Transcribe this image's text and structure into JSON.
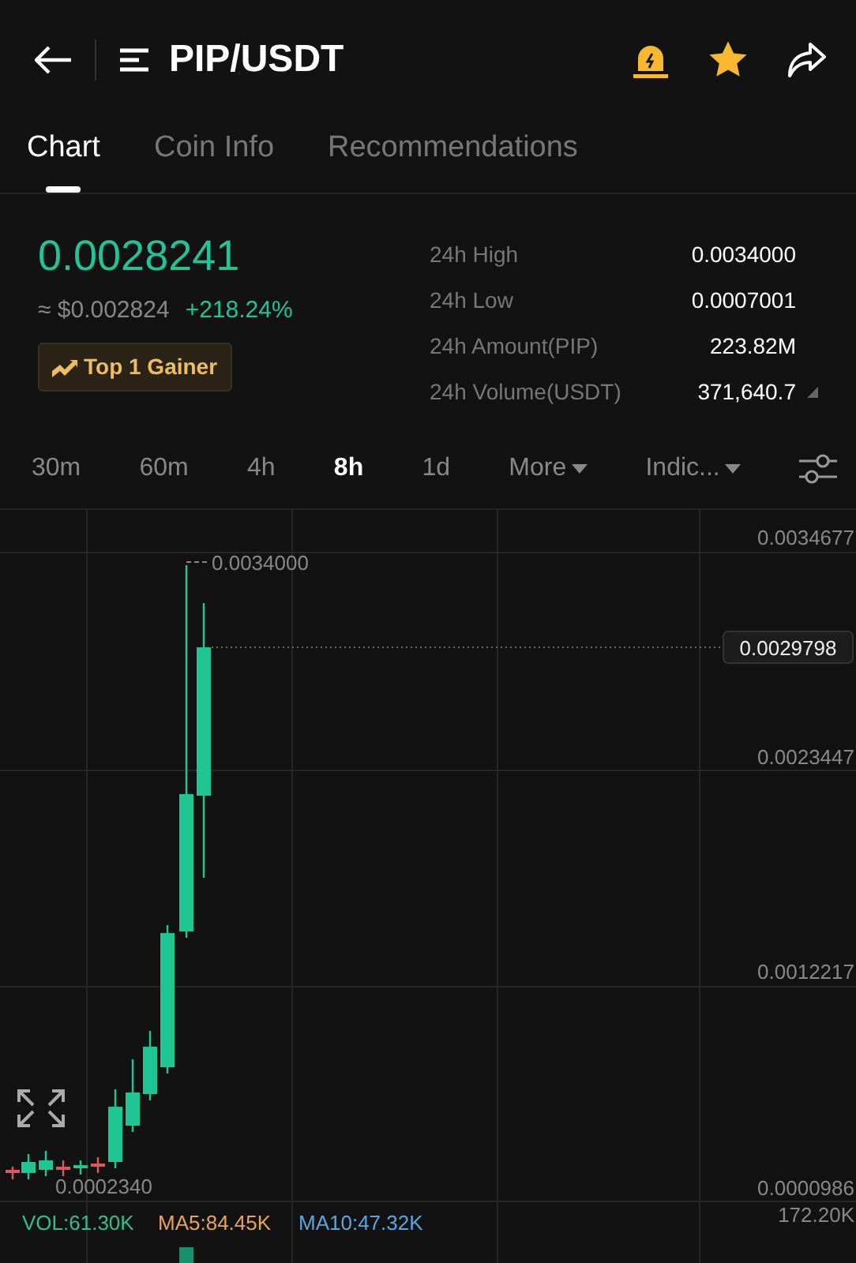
{
  "header": {
    "title": "PIP/USDT"
  },
  "tabs": [
    {
      "label": "Chart",
      "selected": true
    },
    {
      "label": "Coin Info",
      "selected": false
    },
    {
      "label": "Recommendations",
      "selected": false
    }
  ],
  "ticker": {
    "price": "0.0028241",
    "usd_price": "≈ $0.002824",
    "change": "+218.24%",
    "badge": "Top 1 Gainer"
  },
  "stats": [
    {
      "label": "24h High",
      "value": "0.0034000"
    },
    {
      "label": "24h Low",
      "value": "0.0007001"
    },
    {
      "label": "24h Amount(PIP)",
      "value": "223.82M"
    },
    {
      "label": "24h Volume(USDT)",
      "value": "371,640.7"
    }
  ],
  "timeframes": [
    {
      "label": "30m",
      "kind": "interval",
      "selected": false
    },
    {
      "label": "60m",
      "kind": "interval",
      "selected": false
    },
    {
      "label": "4h",
      "kind": "interval",
      "selected": false
    },
    {
      "label": "8h",
      "kind": "interval",
      "selected": true
    },
    {
      "label": "1d",
      "kind": "interval",
      "selected": false
    },
    {
      "label": "More",
      "kind": "menu",
      "selected": false
    },
    {
      "label": "Indic...",
      "kind": "menu",
      "selected": false
    }
  ],
  "chart": {
    "price_axis": [
      "0.0034677",
      "0.0023447",
      "0.0012217",
      "0.0000986"
    ],
    "current_price": "0.0029798",
    "high_marker": "0.0034000",
    "low_marker": "0.0002340",
    "volume_axis": "172.20K",
    "volume_legend": [
      {
        "label": "VOL:61.30K",
        "color": "#2fbf8f"
      },
      {
        "label": "MA5:84.45K",
        "color": "#e8a55a"
      },
      {
        "label": "MA10:47.32K",
        "color": "#5aa7e0"
      }
    ]
  }
}
